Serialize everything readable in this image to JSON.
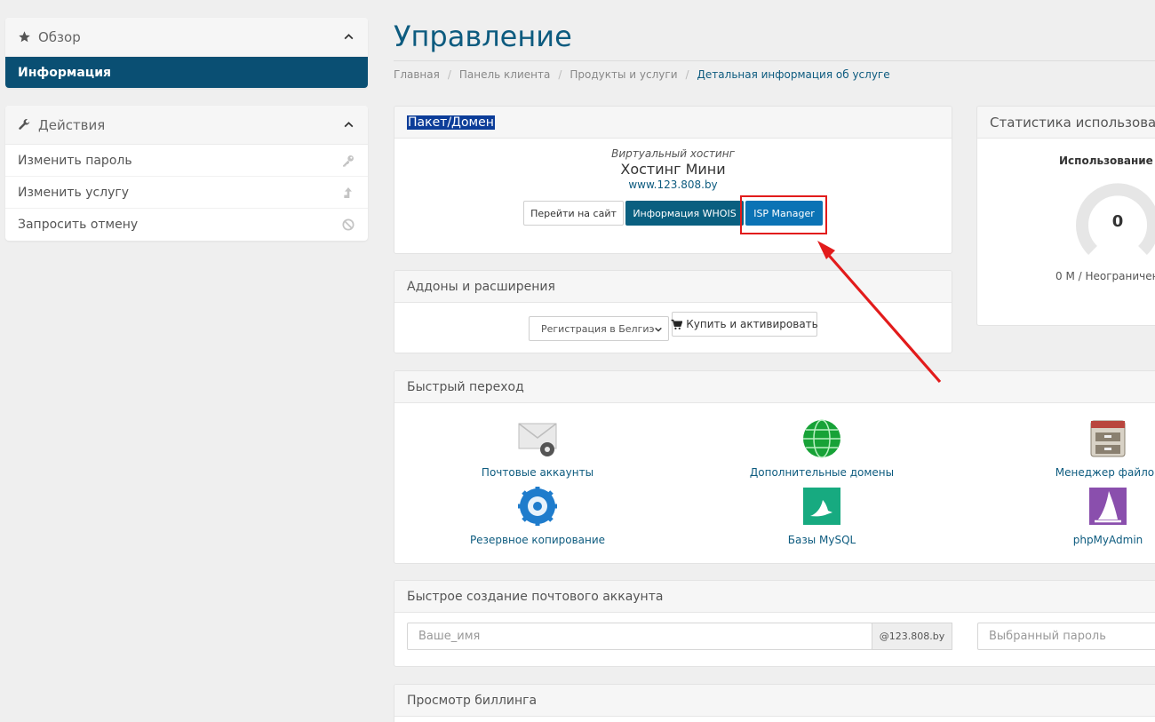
{
  "sidebar": {
    "overview": {
      "title": "Обзор",
      "icon": "star-icon",
      "active_item": "Информация"
    },
    "actions": {
      "title": "Действия",
      "icon": "wrench-icon",
      "items": [
        {
          "label": "Изменить пароль",
          "icon": "key-icon"
        },
        {
          "label": "Изменить услугу",
          "icon": "arrow-up-icon"
        },
        {
          "label": "Запросить отмену",
          "icon": "ban-icon"
        }
      ]
    }
  },
  "main": {
    "title": "Управление",
    "breadcrumb": [
      "Главная",
      "Панель клиента",
      "Продукты и услуги",
      "Детальная информация об услуге"
    ]
  },
  "package": {
    "header": "Пакет/Домен",
    "type": "Виртуальный хостинг",
    "name": "Хостинг Мини",
    "domain": "www.123.808.by",
    "buttons": {
      "visit": "Перейти на сайт",
      "whois": "Информация WHOIS",
      "isp": "ISP Manager"
    }
  },
  "addons": {
    "header": "Аддоны и расширения",
    "select_value": "Регистрация в Белгиэ",
    "buy_label": "Купить и активировать"
  },
  "stats": {
    "header": "Статистика использовани",
    "usage_title": "Использование ди",
    "gauge_value": "0",
    "usage_text": "0 M / Неограничен"
  },
  "quick": {
    "header": "Быстрый переход",
    "items": [
      {
        "label": "Почтовые аккаунты",
        "icon": "mail-settings-icon"
      },
      {
        "label": "Дополнительные домены",
        "icon": "globe-icon"
      },
      {
        "label": "Менеджер файлов",
        "icon": "file-cabinet-icon"
      },
      {
        "label": "Резервное копирование",
        "icon": "backup-gear-icon"
      },
      {
        "label": "Базы MySQL",
        "icon": "mysql-dolphin-icon"
      },
      {
        "label": "phpMyAdmin",
        "icon": "phpmyadmin-sail-icon"
      }
    ]
  },
  "email_create": {
    "header": "Быстрое создание почтового аккаунта",
    "name_placeholder": "Ваше_имя",
    "domain_suffix": "@123.808.by",
    "password_placeholder": "Выбранный пароль"
  },
  "billing": {
    "header": "Просмотр биллинга"
  },
  "colors": {
    "brand": "#0d5b7f",
    "active_nav": "#0a4f73",
    "highlight": "#e21b1b",
    "button_blue": "#0b73b5"
  }
}
